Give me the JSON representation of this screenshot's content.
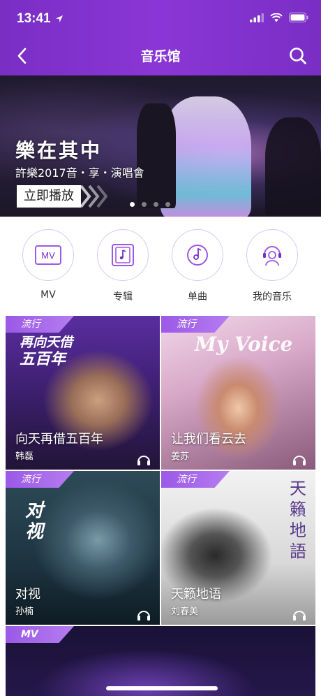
{
  "status_bar": {
    "time": "13:41"
  },
  "nav": {
    "title": "音乐馆"
  },
  "banner": {
    "title": "樂在其中",
    "subtitle": "許樂2017音・享・演唱會",
    "play_label": "立即播放",
    "dots": 4,
    "active_dot": 0
  },
  "categories": [
    {
      "label": "MV",
      "icon": "mv-icon",
      "badge": "MV"
    },
    {
      "label": "专辑",
      "icon": "album-icon"
    },
    {
      "label": "单曲",
      "icon": "single-icon"
    },
    {
      "label": "我的音乐",
      "icon": "my-music-icon"
    }
  ],
  "cards": [
    {
      "tag": "流行",
      "song": "向天再借五百年",
      "artist": "韩磊",
      "cover_text": "再向天借\n五百年",
      "cover_small": "韩磊"
    },
    {
      "tag": "流行",
      "song": "让我们看云去",
      "artist": "姜苏",
      "cover_text": "My Voice"
    },
    {
      "tag": "流行",
      "song": "对视",
      "artist": "孙楠",
      "cover_text": "对视",
      "cover_small": "孙楠"
    },
    {
      "tag": "流行",
      "song": "天籁地语",
      "artist": "刘春美",
      "cover_text": "天籟地語"
    }
  ],
  "wide_card": {
    "tag": "MV"
  },
  "colors": {
    "brand": "#7a2ec4",
    "accent": "#9b59e6"
  }
}
